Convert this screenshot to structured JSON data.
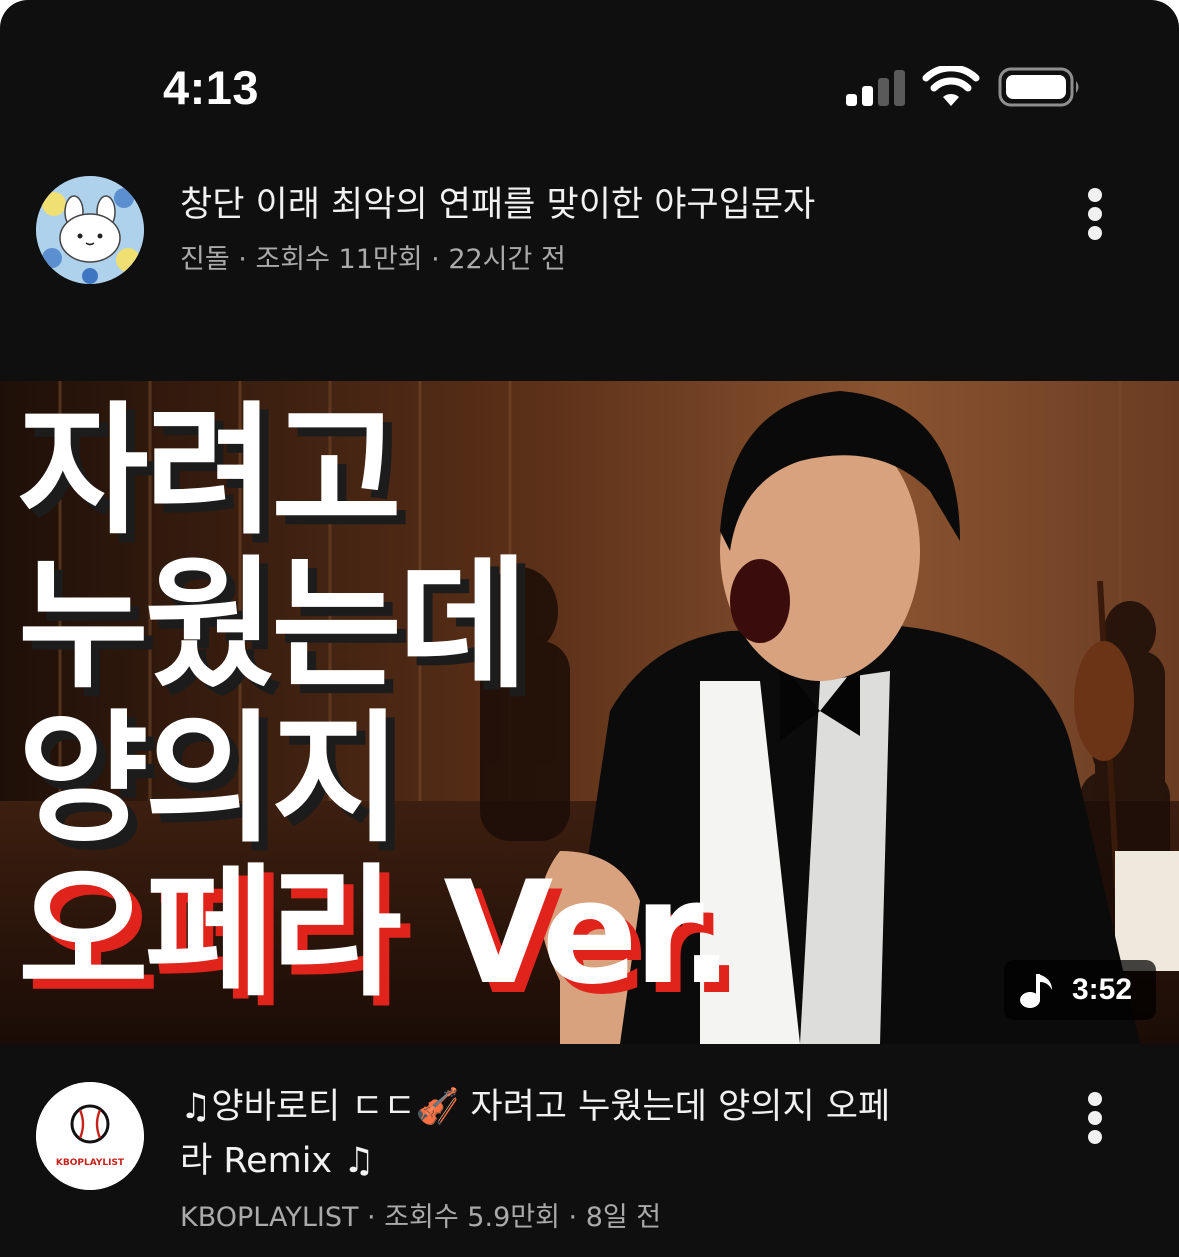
{
  "status_bar": {
    "time": "4:13",
    "icons": [
      "cellular-signal-icon",
      "wifi-icon",
      "battery-icon"
    ]
  },
  "videos": [
    {
      "title": "창단 이래 최악의 연패를 맞이한 야구입문자",
      "channel": "진돌",
      "views": "조회수 11만회",
      "age": "22시간 전",
      "avatar_icon": "white-rabbit-avatar-icon",
      "menu_icon": "more-vert-icon"
    },
    {
      "thumbnail": {
        "lines": [
          "자려고",
          "누웠는데",
          "양의지",
          "오페라 Ver."
        ],
        "duration": "3:52",
        "duration_icon": "music-note-icon"
      },
      "title_line1": "♫양바로티 ㄷㄷ🎻  자려고 누웠는데 양의지 오페",
      "title_line2": "라 Remix ♫",
      "channel": "KBOPLAYLIST",
      "views": "조회수 5.9만회",
      "age": "8일 전",
      "avatar_icon": "baseball-logo-avatar-icon",
      "avatar_text": "KBOPLAYLIST",
      "menu_icon": "more-vert-icon"
    }
  ],
  "separator": " · ",
  "colors": {
    "background": "#0f0f0f",
    "text_primary": "#f1f1f1",
    "text_secondary": "#aaaaaa",
    "thumb_accent": "#e0241c"
  }
}
